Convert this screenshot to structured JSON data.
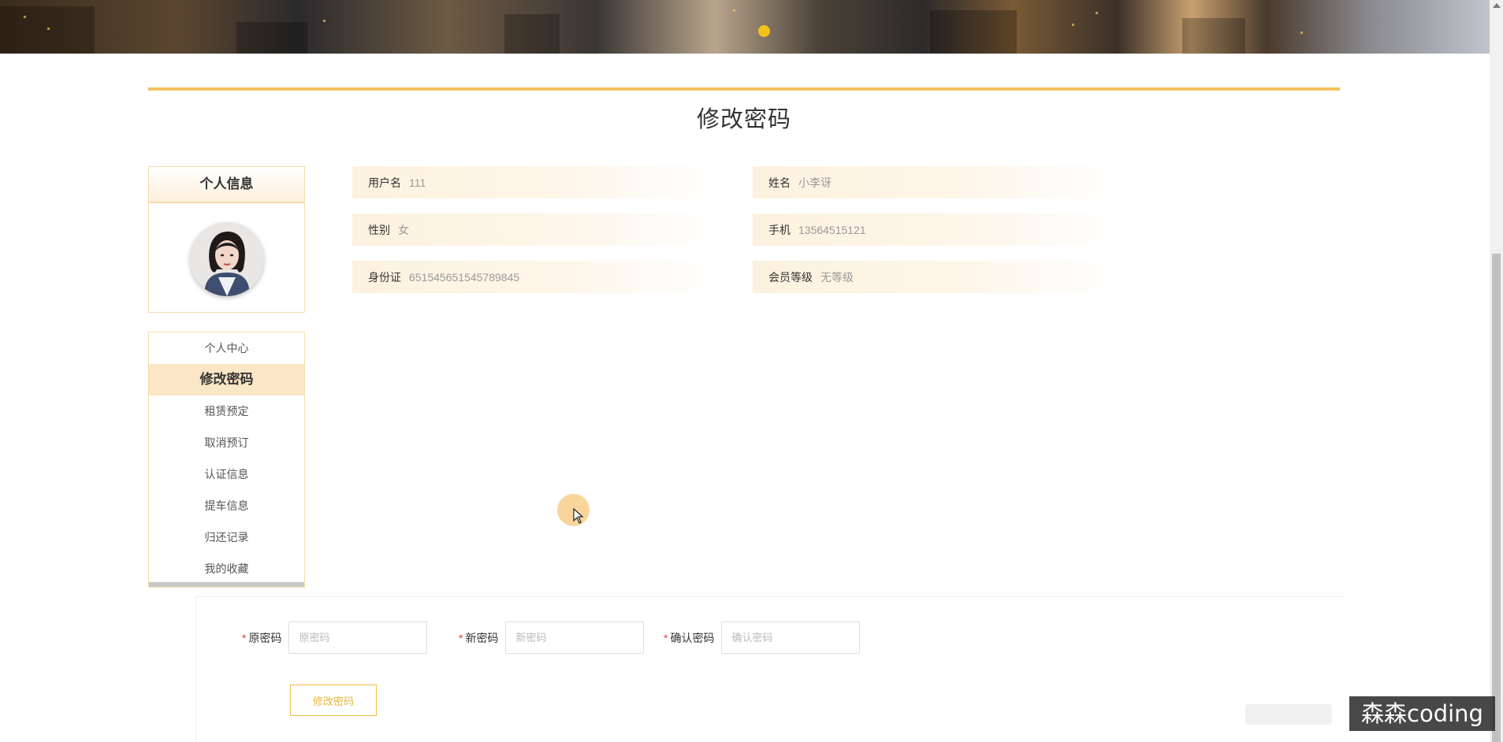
{
  "banner": {
    "indicator_color": "#f0c419"
  },
  "page": {
    "title": "修改密码",
    "accent": "#f2c25c"
  },
  "profile": {
    "heading": "个人信息"
  },
  "menu": {
    "items": [
      {
        "label": "个人中心",
        "active": false
      },
      {
        "label": "修改密码",
        "active": true
      },
      {
        "label": "租赁预定",
        "active": false
      },
      {
        "label": "取消预订",
        "active": false
      },
      {
        "label": "认证信息",
        "active": false
      },
      {
        "label": "提车信息",
        "active": false
      },
      {
        "label": "归还记录",
        "active": false
      },
      {
        "label": "我的收藏",
        "active": false
      }
    ]
  },
  "info": {
    "username": {
      "label": "用户名",
      "value": "111"
    },
    "name": {
      "label": "姓名",
      "value": "小李讶"
    },
    "gender": {
      "label": "性别",
      "value": "女"
    },
    "phone": {
      "label": "手机",
      "value": "13564515121"
    },
    "idcard": {
      "label": "身份证",
      "value": "651545651545789845"
    },
    "member_level": {
      "label": "会员等级",
      "value": "无等级"
    }
  },
  "form": {
    "old_password": {
      "label": "原密码",
      "placeholder": "原密码",
      "value": ""
    },
    "new_password": {
      "label": "新密码",
      "placeholder": "新密码",
      "value": ""
    },
    "confirm_password": {
      "label": "确认密码",
      "placeholder": "确认密码",
      "value": ""
    },
    "required_mark": "*",
    "submit_label": "修改密码"
  },
  "watermark": "森森coding"
}
